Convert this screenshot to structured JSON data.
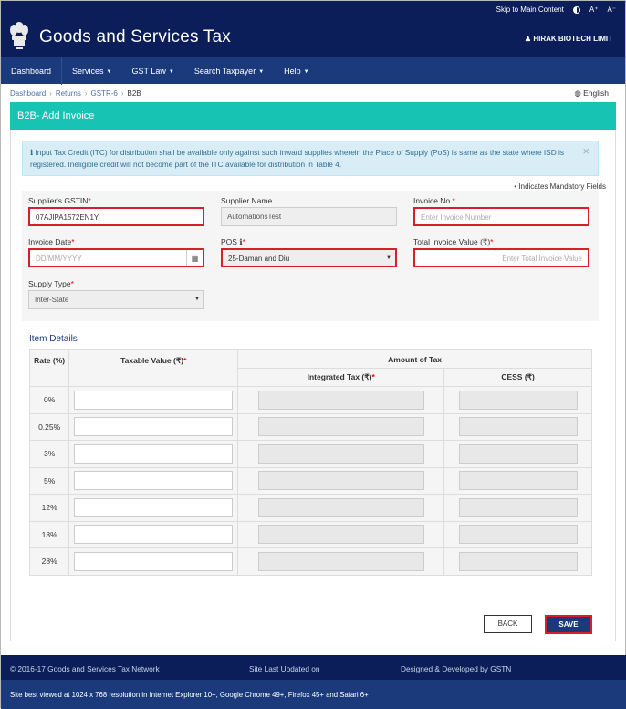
{
  "header": {
    "skip_link": "Skip to Main Content",
    "font_up": "A⁺",
    "font_down": "A⁻",
    "brand": "Goods and Services Tax",
    "user": "HIRAK BIOTECH LIMIT"
  },
  "nav": {
    "items": [
      "Dashboard",
      "Services",
      "GST Law",
      "Search Taxpayer",
      "Help"
    ]
  },
  "breadcrumb": {
    "items": [
      "Dashboard",
      "Returns",
      "GSTR-6",
      "B2B"
    ],
    "language": "English"
  },
  "page": {
    "title": "B2B- Add Invoice",
    "alert": "Input Tax Credit (ITC) for distribution shall be available only against such inward supplies wherein the Place of Supply (PoS) is same as the state where ISD is registered. Ineligible credit will not become part of the ITC available for distribution in Table 4.",
    "mandatory_note": "Indicates Mandatory Fields"
  },
  "form": {
    "supplier_gstin": {
      "label": "Supplier's GSTIN",
      "value": "07AJIPA1572EN1Y"
    },
    "supplier_name": {
      "label": "Supplier Name",
      "value": "AutomationsTest"
    },
    "invoice_no": {
      "label": "Invoice No.",
      "placeholder": "Enter Invoice Number"
    },
    "invoice_date": {
      "label": "Invoice Date",
      "placeholder": "DD/MM/YYYY"
    },
    "pos": {
      "label": "POS",
      "value": "25-Daman and Diu"
    },
    "total_value": {
      "label": "Total Invoice Value (₹)",
      "placeholder": "Enter Total Invoice Value"
    },
    "supply_type": {
      "label": "Supply Type",
      "value": "Inter-State"
    }
  },
  "items": {
    "title": "Item Details",
    "headers": {
      "rate": "Rate (%)",
      "taxable": "Taxable Value (₹)",
      "amount": "Amount of Tax",
      "igst": "Integrated Tax (₹)",
      "cess": "CESS (₹)"
    },
    "rates": [
      "0%",
      "0.25%",
      "3%",
      "5%",
      "12%",
      "18%",
      "28%"
    ]
  },
  "buttons": {
    "back": "BACK",
    "save": "SAVE"
  },
  "footer": {
    "copyright": "© 2016-17 Goods and Services Tax Network",
    "updated": "Site Last Updated on",
    "designed": "Designed & Developed by GSTN",
    "note": "Site best viewed at 1024 x 768 resolution in Internet Explorer 10+, Google Chrome 49+, Firefox 45+ and Safari 6+"
  }
}
